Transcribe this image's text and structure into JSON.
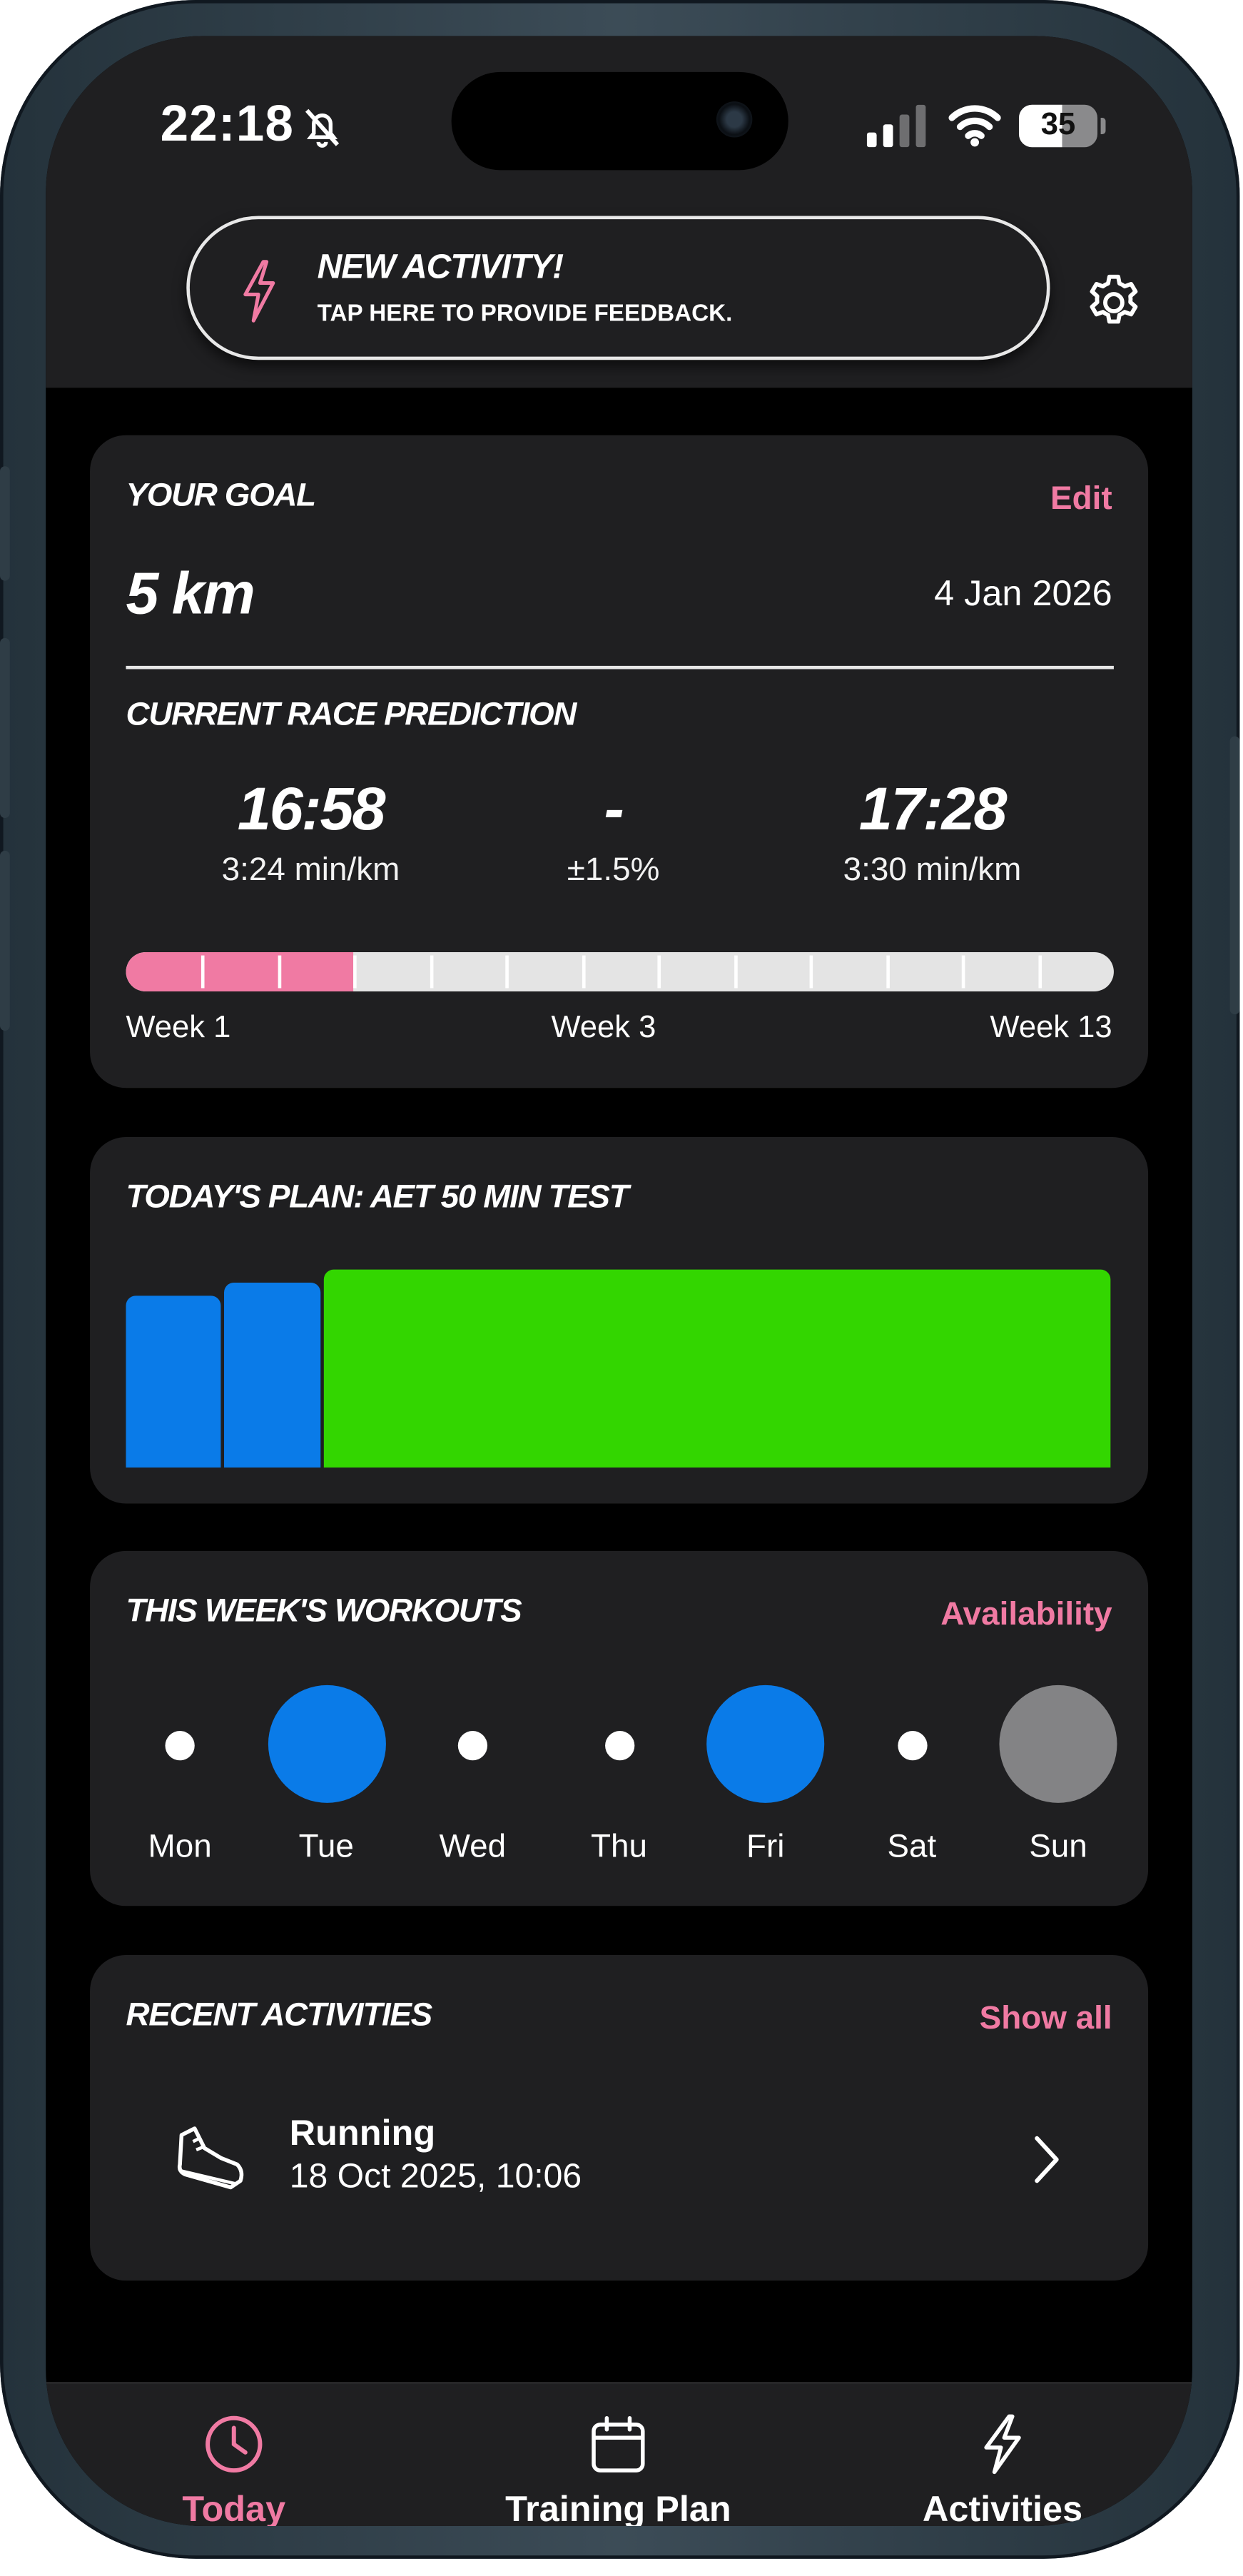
{
  "status_bar": {
    "time": "22:18",
    "battery": "35"
  },
  "banner": {
    "title": "NEW ACTIVITY!",
    "subtitle": "TAP HERE TO PROVIDE FEEDBACK."
  },
  "goal": {
    "title": "YOUR GOAL",
    "edit_label": "Edit",
    "distance": "5 km",
    "date": "4 Jan 2026",
    "prediction_title": "CURRENT RACE PREDICTION",
    "best_time": "16:58",
    "best_pace": "3:24 min/km",
    "separator": "-",
    "margin": "±1.5%",
    "worst_time": "17:28",
    "worst_pace": "3:30 min/km",
    "progress": {
      "current_week": 3,
      "total_weeks": 13,
      "fill_fraction": 0.23
    },
    "week_labels": {
      "start": "Week 1",
      "current": "Week 3",
      "end": "Week 13"
    }
  },
  "todays_plan": {
    "title": "TODAY'S PLAN: AET 50 MIN TEST",
    "segments": [
      {
        "share": 0.1,
        "intensity": 0.87,
        "color": "#0a7be8"
      },
      {
        "share": 0.1,
        "intensity": 0.93,
        "color": "#0a7be8"
      },
      {
        "share": 0.8,
        "intensity": 1.0,
        "color": "#33d600"
      }
    ]
  },
  "week": {
    "title": "THIS WEEK'S WORKOUTS",
    "availability_label": "Availability",
    "days": [
      {
        "label": "Mon",
        "state": "rest"
      },
      {
        "label": "Tue",
        "state": "workout",
        "color": "#0a7be8"
      },
      {
        "label": "Wed",
        "state": "rest"
      },
      {
        "label": "Thu",
        "state": "rest"
      },
      {
        "label": "Fri",
        "state": "workout",
        "color": "#0a7be8"
      },
      {
        "label": "Sat",
        "state": "rest"
      },
      {
        "label": "Sun",
        "state": "workout",
        "color": "#838385"
      }
    ]
  },
  "recent": {
    "title": "RECENT ACTIVITIES",
    "show_all_label": "Show all",
    "items": [
      {
        "name": "Running",
        "date": "18 Oct 2025, 10:06",
        "icon": "running-shoe-icon"
      }
    ]
  },
  "tabs": [
    {
      "label": "Today",
      "icon": "clock-icon",
      "active": true
    },
    {
      "label": "Training Plan",
      "icon": "calendar-icon",
      "active": false
    },
    {
      "label": "Activities",
      "icon": "bolt-icon",
      "active": false
    }
  ],
  "colors": {
    "accent": "#f07aa3",
    "card_bg": "#1f1f21",
    "blue": "#0a7be8",
    "green": "#33d600"
  }
}
